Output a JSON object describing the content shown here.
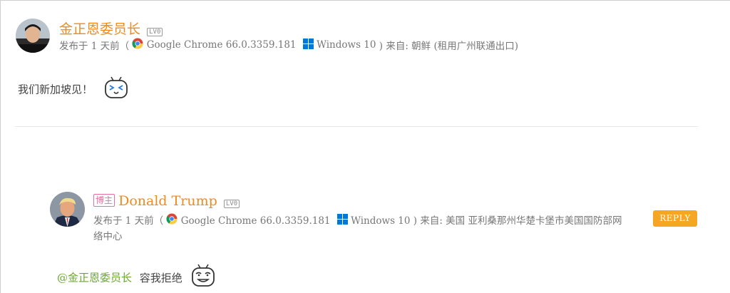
{
  "comment1": {
    "author": "金正恩委员长",
    "level_badge": "LV0",
    "posted": "发布于 1 天前（",
    "browser": "Google Chrome 66.0.3359.181",
    "os": "Windows 10",
    "from": ") 来自: 朝鲜 (租用广州联通出口)",
    "text": "我们新加坡见！",
    "emoji_icon": "bilibili-tv-grin-icon"
  },
  "comment2": {
    "badge": "博主",
    "author": "Donald Trump",
    "level_badge": "LV0",
    "posted": "发布于 1 天前（",
    "browser": "Google Chrome 66.0.3359.181",
    "os": "Windows 10",
    "from_line1": ") 来自: 美国 亚利桑那州华楚卡堡市美国国防部网",
    "from_line2": "络中心",
    "reply_label": "REPLY",
    "mention": "@金正恩委员长",
    "text": "容我拒绝",
    "emoji_icon": "bilibili-tv-smug-icon"
  },
  "colors": {
    "author": "#f08a1c",
    "reply_button": "#f5a623",
    "mention": "#6aa830",
    "blogger_badge": "#e56fa1"
  }
}
